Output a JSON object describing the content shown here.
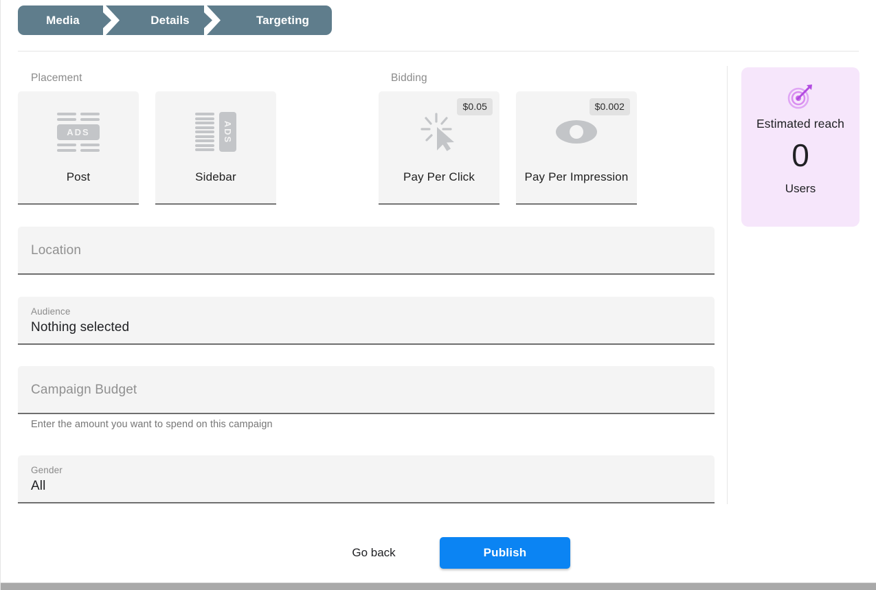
{
  "stepper": {
    "steps": [
      {
        "label": "Media"
      },
      {
        "label": "Details"
      },
      {
        "label": "Targeting"
      }
    ],
    "active_color": "#5f7d8c"
  },
  "sections": {
    "placement_label": "Placement",
    "bidding_label": "Bidding"
  },
  "placement": {
    "options": [
      {
        "label": "Post",
        "icon": "ads-post-icon",
        "ads_text": "ADS"
      },
      {
        "label": "Sidebar",
        "icon": "ads-sidebar-icon",
        "ads_text": "ADS"
      }
    ]
  },
  "bidding": {
    "options": [
      {
        "label": "Pay Per Click",
        "price": "$0.05",
        "icon": "cursor-click-icon"
      },
      {
        "label": "Pay Per Impression",
        "price": "$0.002",
        "icon": "eye-icon"
      }
    ]
  },
  "estimated_reach": {
    "icon": "target-dart-icon",
    "title": "Estimated reach",
    "value": "0",
    "unit": "Users",
    "background": "#f6e6fb",
    "icon_color": "#b14ae0"
  },
  "form": {
    "location": {
      "placeholder": "Location",
      "value": ""
    },
    "audience": {
      "label": "Audience",
      "value": "Nothing selected"
    },
    "campaign_budget": {
      "placeholder": "Campaign Budget",
      "value": "",
      "helper": "Enter the amount you want to spend on this campaign"
    },
    "gender": {
      "label": "Gender",
      "value": "All"
    }
  },
  "footer": {
    "go_back_label": "Go back",
    "publish_label": "Publish",
    "publish_color": "#0b84f3"
  }
}
